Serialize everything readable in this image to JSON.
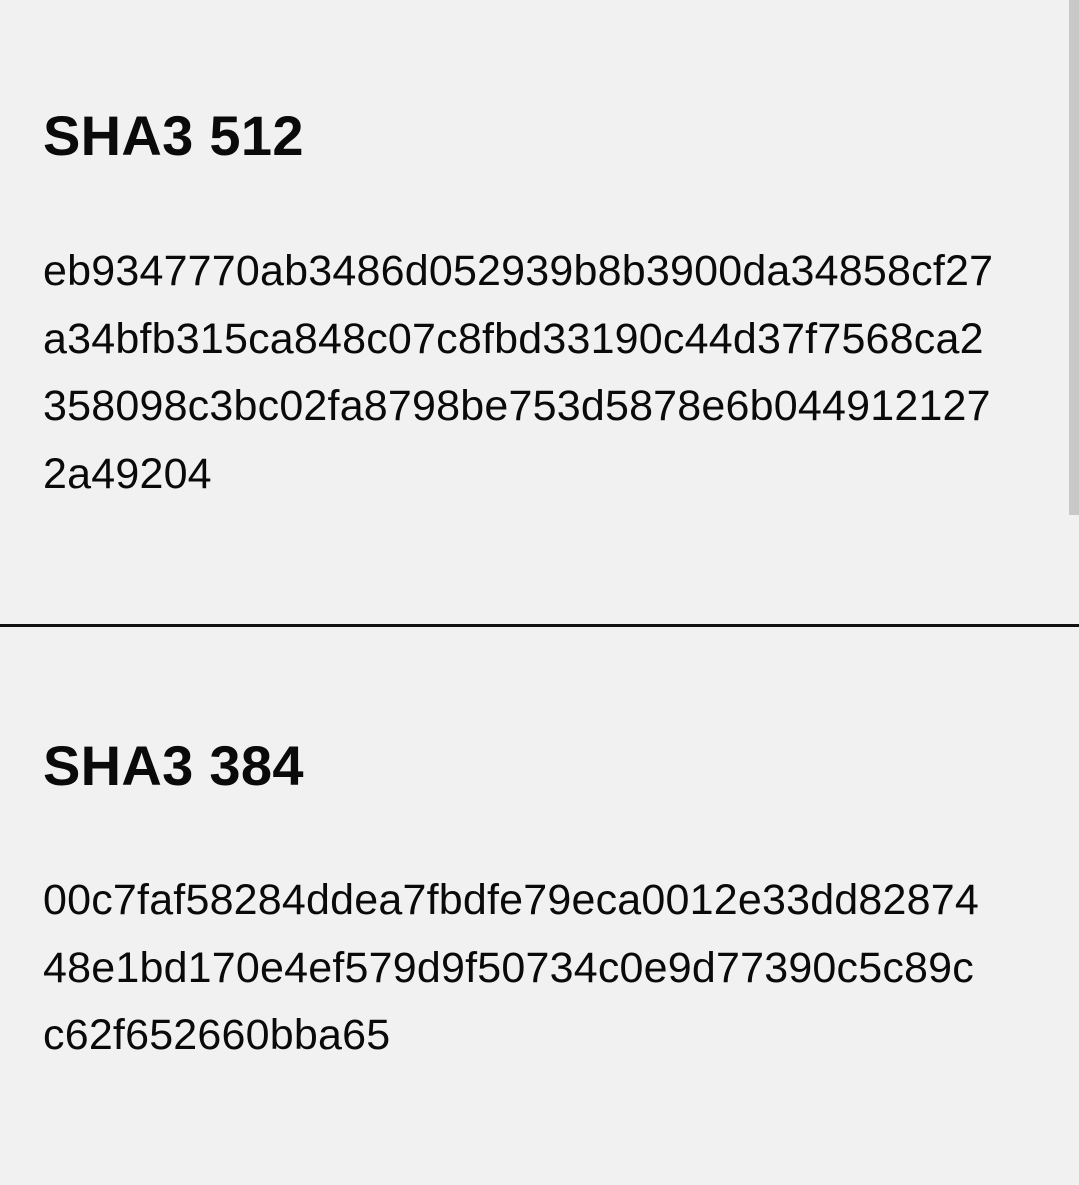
{
  "sections": [
    {
      "title": "SHA3 512",
      "hash_lines": [
        "eb9347770ab3486d052939b8b3900da34858cf27",
        "a34bfb315ca848c07c8fbd33190c44d37f7568ca2",
        "358098c3bc02fa8798be753d5878e6b044912127",
        "2a49204"
      ]
    },
    {
      "title": "SHA3 384",
      "hash_lines": [
        "00c7faf58284ddea7fbdfe79eca0012e33dd82874",
        "48e1bd170e4ef579d9f50734c0e9d77390c5c89c",
        "c62f652660bba65"
      ]
    }
  ],
  "colors": {
    "background": "#f1f1f1",
    "text": "#0a0a0a",
    "divider": "#111111",
    "scrollbar": "#c8c8c8"
  }
}
